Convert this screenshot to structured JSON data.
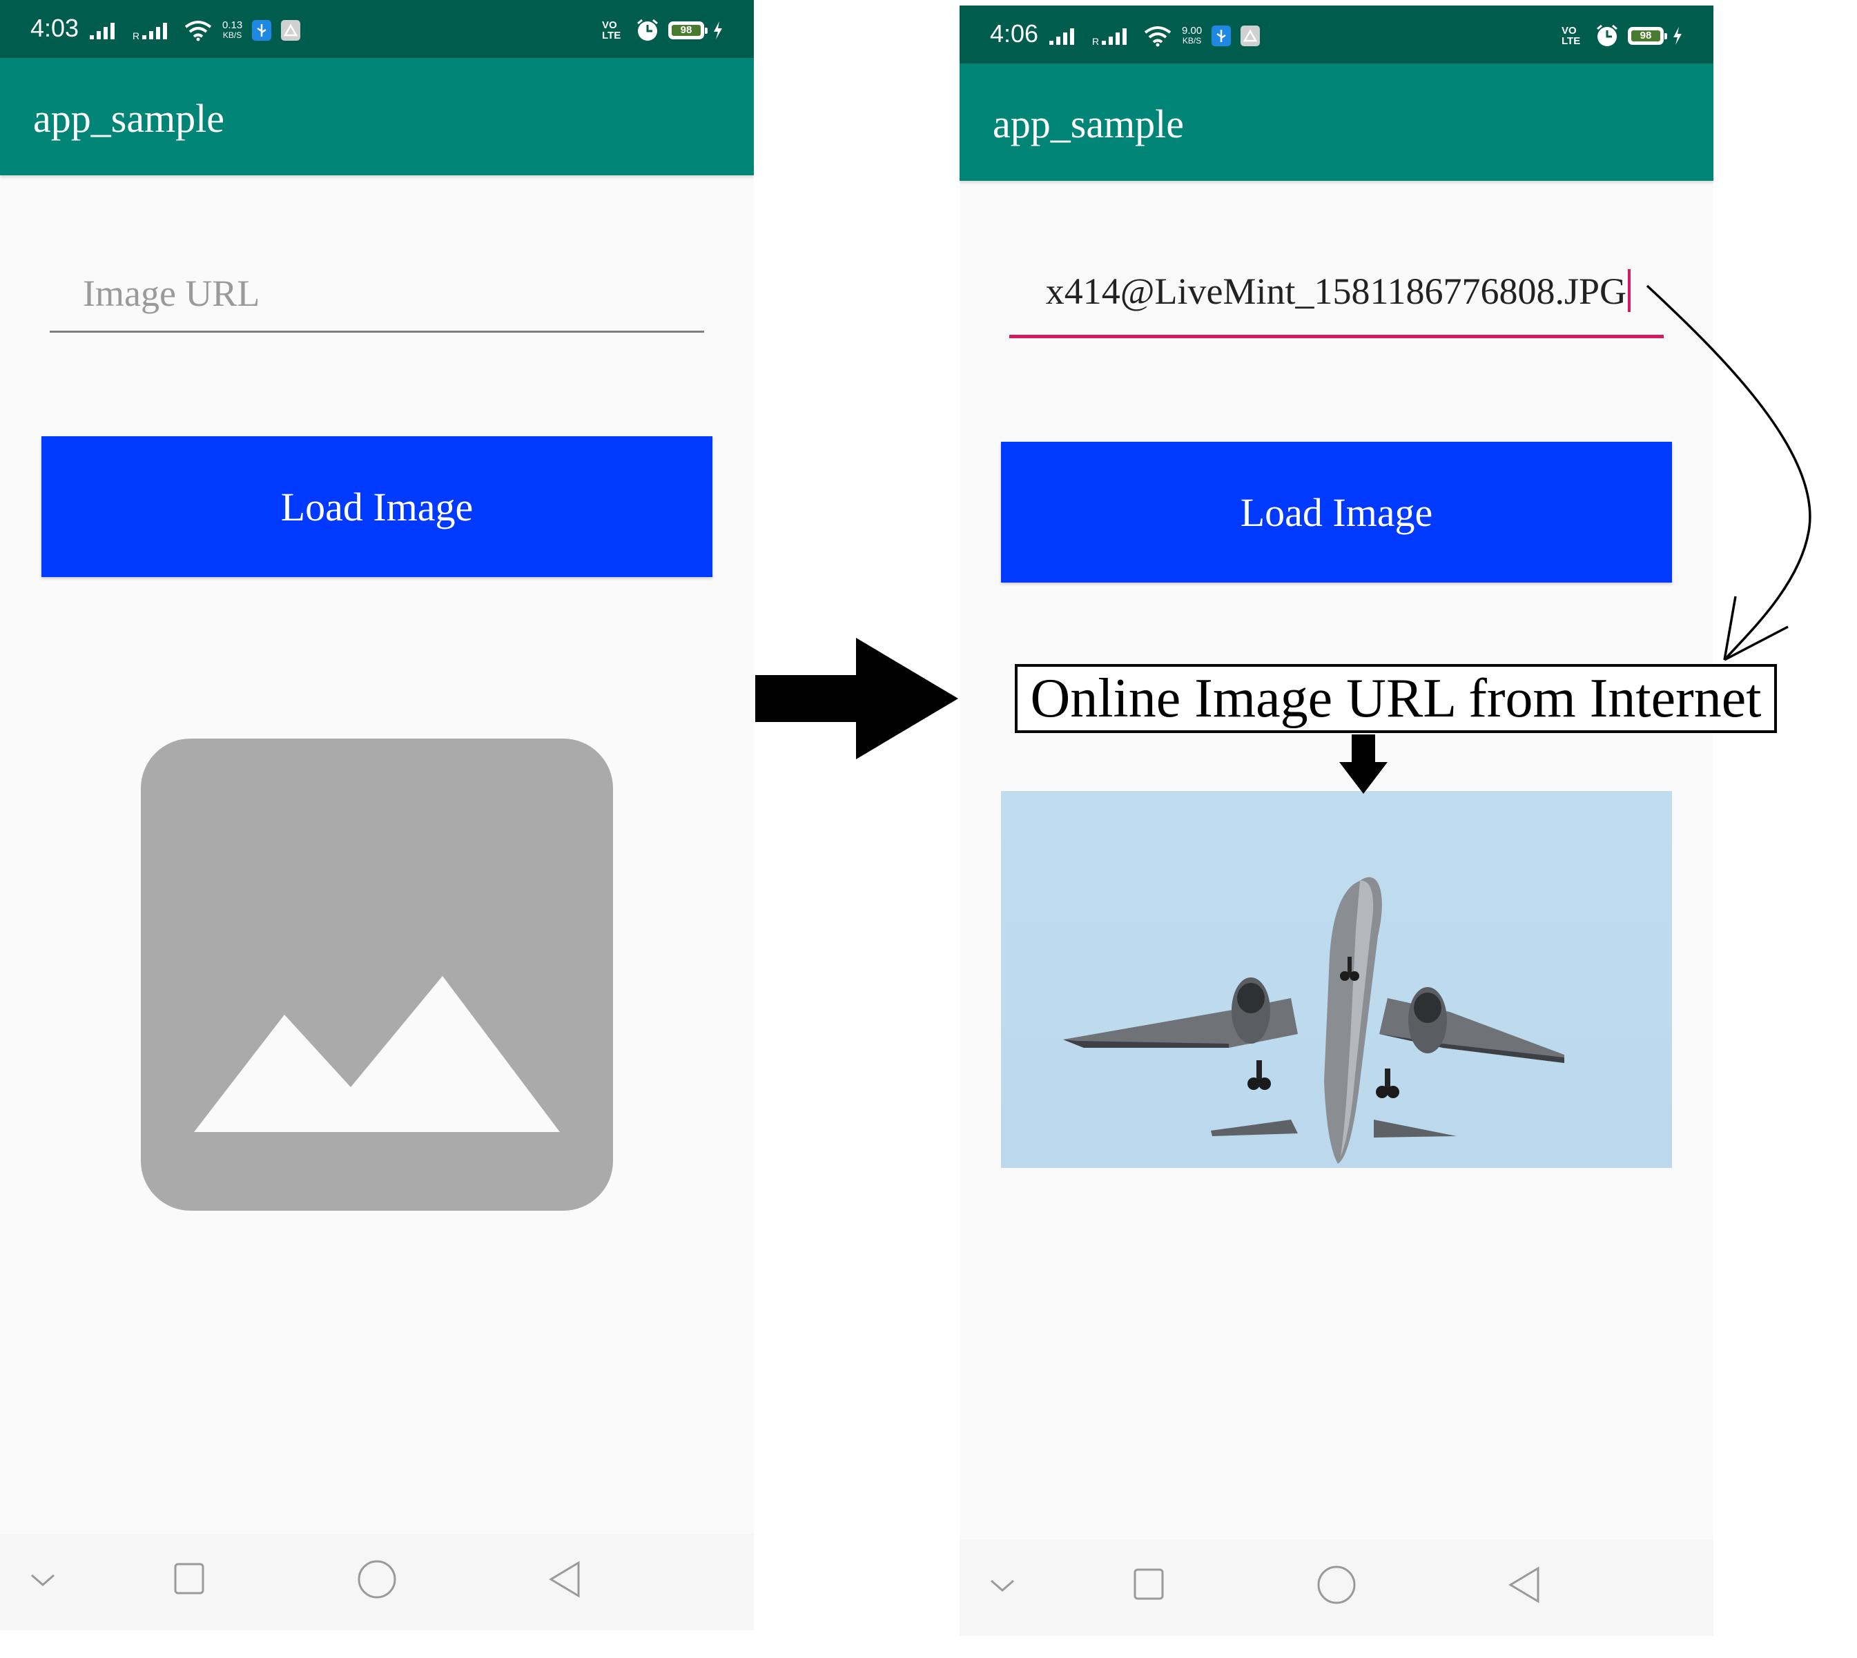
{
  "left_screen": {
    "status_bar": {
      "time": "4:03",
      "network_speed": "0.13",
      "speed_unit": "KB/S",
      "volte": "VO LTE",
      "battery": "98"
    },
    "app_bar": {
      "title": "app_sample"
    },
    "url_input": {
      "placeholder": "Image URL",
      "value": ""
    },
    "load_button": {
      "label": "Load Image"
    },
    "image_view": {
      "state": "placeholder",
      "icon": "image-placeholder-icon"
    },
    "nav_bar": {
      "icons": [
        "chevron-down-icon",
        "square-icon",
        "circle-icon",
        "back-triangle-icon"
      ]
    }
  },
  "right_screen": {
    "status_bar": {
      "time": "4:06",
      "network_speed": "9.00",
      "speed_unit": "KB/S",
      "volte": "VO LTE",
      "battery": "98"
    },
    "app_bar": {
      "title": "app_sample"
    },
    "url_input": {
      "value": "x414@LiveMint_1581186776808.JPG"
    },
    "load_button": {
      "label": "Load Image"
    },
    "image_view": {
      "state": "loaded",
      "content": "airplane-photo"
    },
    "nav_bar": {
      "icons": [
        "chevron-down-icon",
        "square-icon",
        "circle-icon",
        "back-triangle-icon"
      ]
    }
  },
  "annotation": {
    "callout_text": "Online Image URL from Internet"
  },
  "colors": {
    "status_bar": "#005c4d",
    "app_bar": "#008577",
    "button": "#0039ff",
    "input_focus": "#d81b60",
    "placeholder_image": "#aaaaaa",
    "screen_background": "#fafafa"
  }
}
